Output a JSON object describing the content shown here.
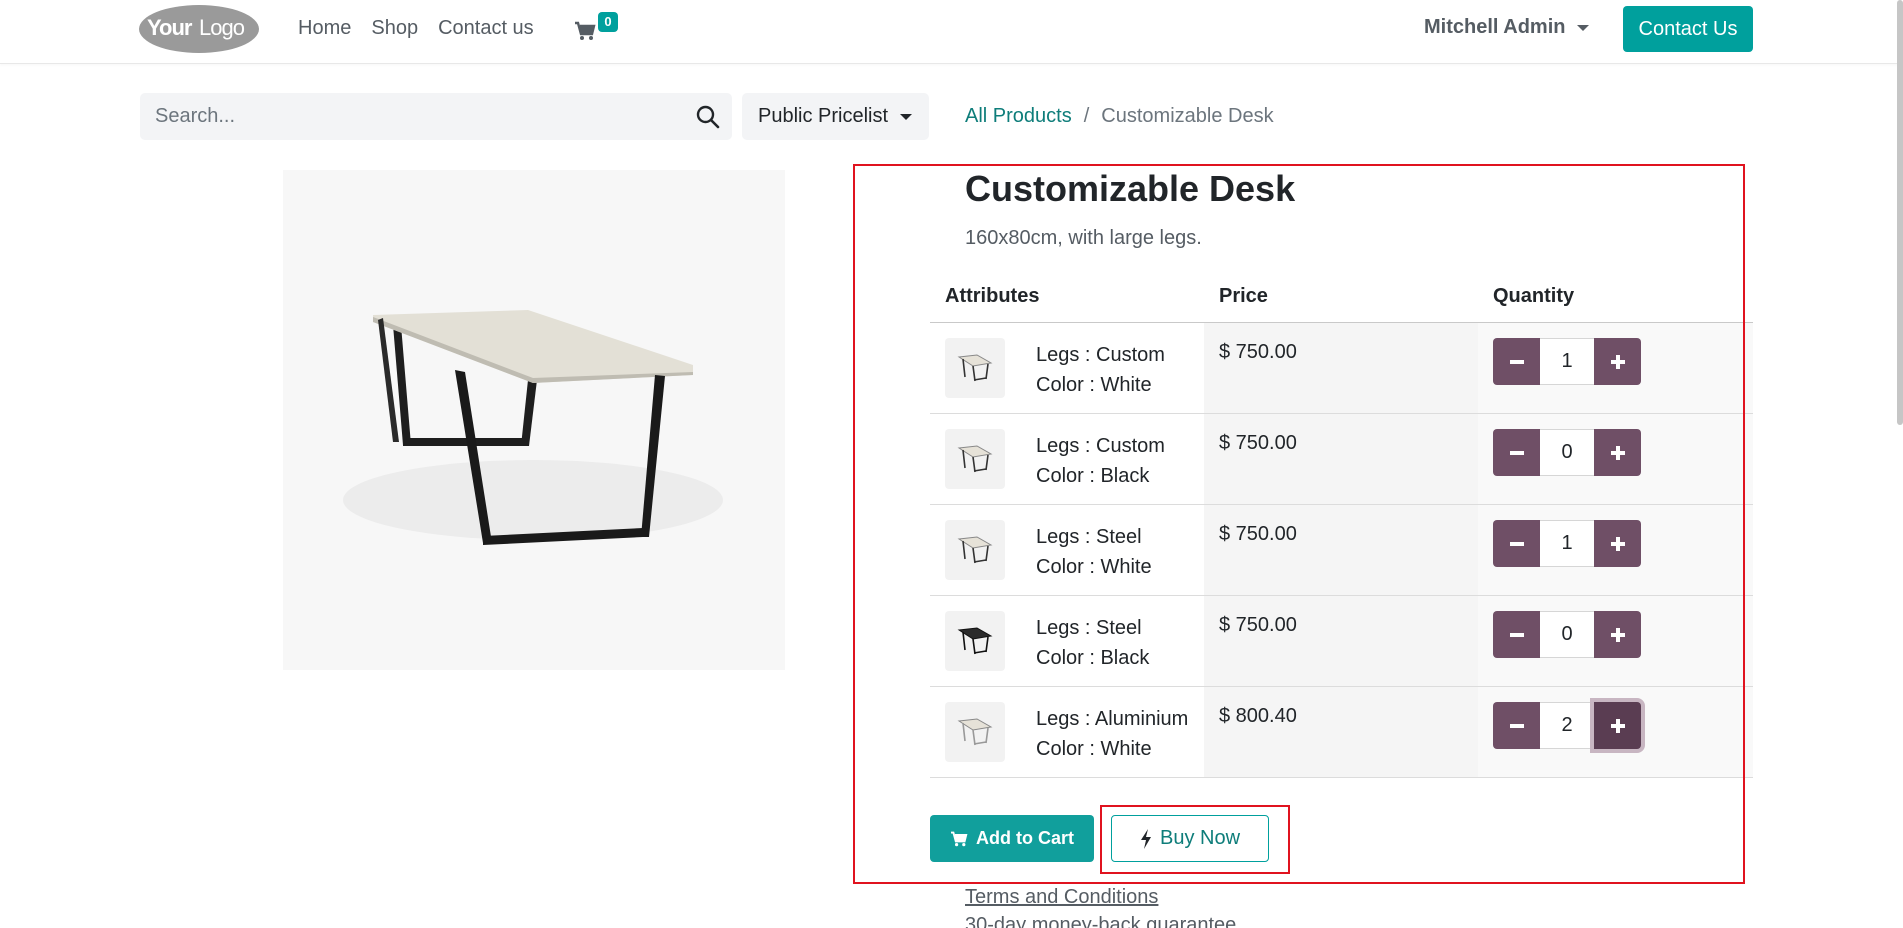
{
  "header": {
    "logo_text": "YourLogo",
    "nav": [
      "Home",
      "Shop",
      "Contact us"
    ],
    "cart_count": "0",
    "user_name": "Mitchell Admin",
    "contact_button": "Contact Us"
  },
  "search": {
    "placeholder": "Search...",
    "pricelist": "Public Pricelist"
  },
  "breadcrumb": {
    "parent": "All Products",
    "separator": "/",
    "current": "Customizable Desk"
  },
  "product": {
    "title": "Customizable Desk",
    "description": "160x80cm, with large legs."
  },
  "table": {
    "headers": {
      "attributes": "Attributes",
      "price": "Price",
      "quantity": "Quantity"
    },
    "rows": [
      {
        "legs": "Legs : Custom",
        "color": "Color : White",
        "price": "$ 750.00",
        "qty": "1",
        "thumb": "white-desk"
      },
      {
        "legs": "Legs : Custom",
        "color": "Color : Black",
        "price": "$ 750.00",
        "qty": "0",
        "thumb": "white-desk"
      },
      {
        "legs": "Legs : Steel",
        "color": "Color : White",
        "price": "$ 750.00",
        "qty": "1",
        "thumb": "white-desk"
      },
      {
        "legs": "Legs : Steel",
        "color": "Color : Black",
        "price": "$ 750.00",
        "qty": "0",
        "thumb": "black-desk"
      },
      {
        "legs": "Legs : Aluminium",
        "color": "Color : White",
        "price": "$ 800.40",
        "qty": "2",
        "thumb": "white-desk"
      }
    ]
  },
  "actions": {
    "add_to_cart": "Add to Cart",
    "buy_now": "Buy Now"
  },
  "footer_links": {
    "terms": "Terms and Conditions",
    "guarantee": "30-day money-back guarantee"
  },
  "colors": {
    "primary": "#00a09d",
    "secondary": "#6f4f66",
    "highlight": "#e0131f"
  }
}
